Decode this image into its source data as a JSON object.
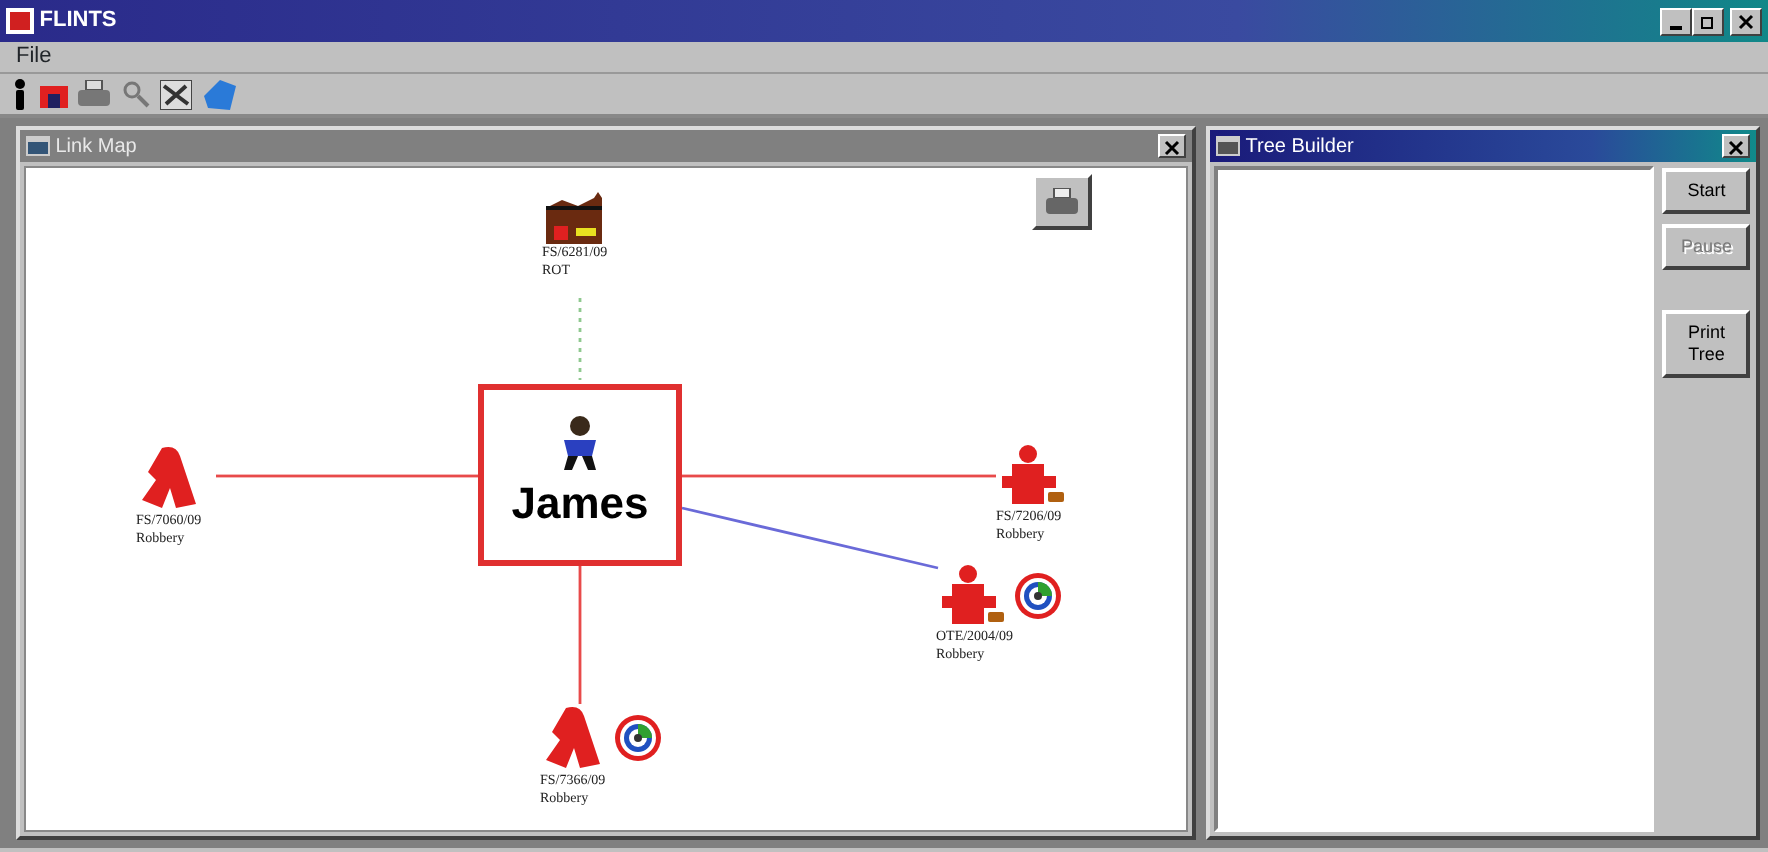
{
  "window": {
    "title": "FLINTS"
  },
  "menu": [
    {
      "label": "File"
    }
  ],
  "link_map": {
    "title": "Link Map",
    "center": {
      "label": "James"
    },
    "nodes": [
      {
        "kind": "premises",
        "lines": [
          "FS/6281/09",
          "ROT"
        ],
        "flagged": false,
        "link": {
          "color": "#8fc98f",
          "dashed": true
        }
      },
      {
        "kind": "offender",
        "lines": [
          "FS/7060/09",
          "Robbery"
        ],
        "flagged": false,
        "link": {
          "color": "#e84a4a",
          "dashed": false
        }
      },
      {
        "kind": "victim",
        "lines": [
          "FS/7206/09",
          "Robbery"
        ],
        "flagged": false,
        "link": {
          "color": "#e84a4a",
          "dashed": false
        }
      },
      {
        "kind": "victim",
        "lines": [
          "OTE/2004/09",
          "Robbery"
        ],
        "flagged": true,
        "link": {
          "color": "#6a6ad8",
          "dashed": false
        }
      },
      {
        "kind": "offender",
        "lines": [
          "FS/7366/09",
          "Robbery"
        ],
        "flagged": true,
        "link": {
          "color": "#e84a4a",
          "dashed": false
        }
      }
    ]
  },
  "tree_builder": {
    "title": "Tree Builder",
    "buttons": [
      {
        "label": "Start",
        "disabled": false
      },
      {
        "label": "Pause",
        "disabled": true
      },
      {
        "label": "Print Tree",
        "disabled": false
      }
    ]
  }
}
